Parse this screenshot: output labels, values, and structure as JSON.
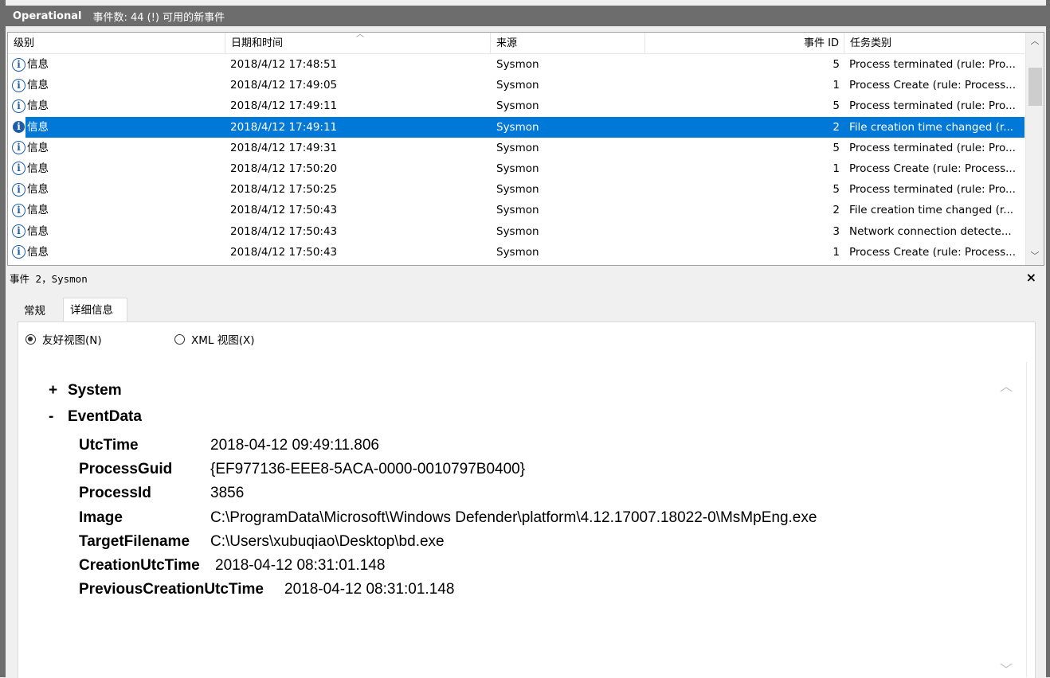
{
  "titlebar": {
    "log_name": "Operational",
    "event_count_text": "事件数: 44 (!) 可用的新事件"
  },
  "columns": {
    "level": "级别",
    "datetime": "日期和时间",
    "source": "来源",
    "event_id": "事件 ID",
    "task_category": "任务类别"
  },
  "events": [
    {
      "level": "信息",
      "datetime": "2018/4/12 17:48:51",
      "source": "Sysmon",
      "event_id": "5",
      "task": "Process terminated (rule: Pro..."
    },
    {
      "level": "信息",
      "datetime": "2018/4/12 17:49:05",
      "source": "Sysmon",
      "event_id": "1",
      "task": "Process Create (rule: Process..."
    },
    {
      "level": "信息",
      "datetime": "2018/4/12 17:49:11",
      "source": "Sysmon",
      "event_id": "5",
      "task": "Process terminated (rule: Pro..."
    },
    {
      "level": "信息",
      "datetime": "2018/4/12 17:49:11",
      "source": "Sysmon",
      "event_id": "2",
      "task": "File creation time changed (r..."
    },
    {
      "level": "信息",
      "datetime": "2018/4/12 17:49:31",
      "source": "Sysmon",
      "event_id": "5",
      "task": "Process terminated (rule: Pro..."
    },
    {
      "level": "信息",
      "datetime": "2018/4/12 17:50:20",
      "source": "Sysmon",
      "event_id": "1",
      "task": "Process Create (rule: Process..."
    },
    {
      "level": "信息",
      "datetime": "2018/4/12 17:50:25",
      "source": "Sysmon",
      "event_id": "5",
      "task": "Process terminated (rule: Pro..."
    },
    {
      "level": "信息",
      "datetime": "2018/4/12 17:50:43",
      "source": "Sysmon",
      "event_id": "2",
      "task": "File creation time changed (r..."
    },
    {
      "level": "信息",
      "datetime": "2018/4/12 17:50:43",
      "source": "Sysmon",
      "event_id": "3",
      "task": "Network connection detecte..."
    },
    {
      "level": "信息",
      "datetime": "2018/4/12 17:50:43",
      "source": "Sysmon",
      "event_id": "1",
      "task": "Process Create (rule: Process..."
    }
  ],
  "selected_index": 3,
  "detail": {
    "title_prefix": "事件",
    "title_rest": " 2，Sysmon",
    "close_glyph": "×",
    "tabs": {
      "general": "常规",
      "details": "详细信息"
    },
    "view_friendly": "友好视图(N)",
    "view_xml": "XML 视图(X)",
    "system_sign": "+",
    "system_label": "System",
    "eventdata_sign": "-",
    "eventdata_label": "EventData",
    "fields": [
      {
        "key": "UtcTime",
        "value": "2018-04-12 09:49:11.806"
      },
      {
        "key": "ProcessGuid",
        "value": "{EF977136-EEE8-5ACA-0000-0010797B0400}"
      },
      {
        "key": "ProcessId",
        "value": "3856"
      },
      {
        "key": "Image",
        "value": "C:\\ProgramData\\Microsoft\\Windows Defender\\platform\\4.12.17007.18022-0\\MsMpEng.exe"
      },
      {
        "key": "TargetFilename",
        "value": "C:\\Users\\xubuqiao\\Desktop\\bd.exe"
      },
      {
        "key": "CreationUtcTime",
        "value": "2018-04-12 08:31:01.148"
      },
      {
        "key": "PreviousCreationUtcTime",
        "value": "2018-04-12 08:31:01.148"
      }
    ]
  },
  "colors": {
    "selection": "#0078d7",
    "frame": "#6d6d6d",
    "info_icon": "#1d5ea8"
  },
  "icons": {
    "level_icon": "info-icon"
  }
}
